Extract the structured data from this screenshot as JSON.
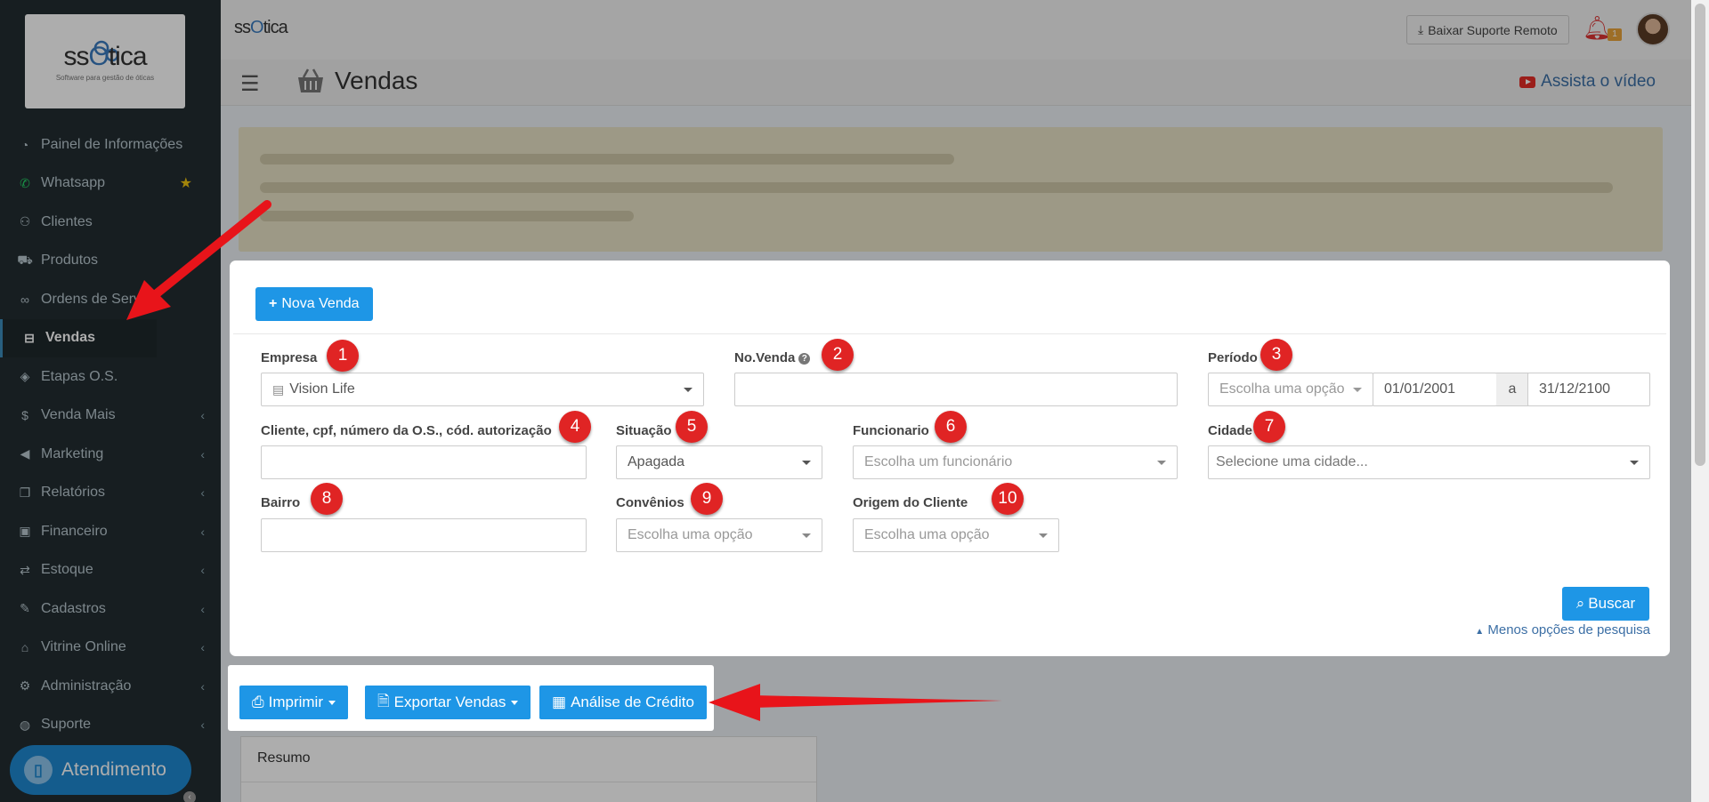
{
  "brand": {
    "name_prefix": "ss",
    "name_o": "O",
    "name_suffix": "tica",
    "tagline": "Software para gestão de óticas"
  },
  "sidebar": {
    "items": [
      {
        "label": "Painel de Informações",
        "icon": "dashboard-icon"
      },
      {
        "label": "Whatsapp",
        "icon": "whatsapp-icon"
      },
      {
        "label": "Clientes",
        "icon": "users-icon"
      },
      {
        "label": "Produtos",
        "icon": "cart-icon"
      },
      {
        "label": "Ordens de Serviço",
        "icon": "glasses-icon"
      },
      {
        "label": "Vendas",
        "icon": "basket-icon"
      },
      {
        "label": "Etapas O.S.",
        "icon": "tag-icon"
      },
      {
        "label": "Venda Mais",
        "icon": "dollar-icon"
      },
      {
        "label": "Marketing",
        "icon": "bullhorn-icon"
      },
      {
        "label": "Relatórios",
        "icon": "copy-icon"
      },
      {
        "label": "Financeiro",
        "icon": "money-icon"
      },
      {
        "label": "Estoque",
        "icon": "exchange-icon"
      },
      {
        "label": "Cadastros",
        "icon": "edit-icon"
      },
      {
        "label": "Vitrine Online",
        "icon": "shop-icon"
      },
      {
        "label": "Administração",
        "icon": "cogs-icon"
      },
      {
        "label": "Suporte",
        "icon": "globe-icon"
      }
    ],
    "support_button": "Atendimento"
  },
  "topbar": {
    "remote_support": "Baixar Suporte Remoto",
    "notification_count": "1"
  },
  "page": {
    "title": "Vendas",
    "video_link": "Assista o vídeo"
  },
  "search": {
    "new_sale": "Nova Venda",
    "company_label": "Empresa",
    "company_value": "Vision Life",
    "sale_number_label": "No.Venda",
    "period_label": "Período",
    "period_placeholder": "Escolha uma opção",
    "date_from": "01/01/2001",
    "date_separator": "a",
    "date_to": "31/12/2100",
    "client_label": "Cliente, cpf, número da O.S., cód. autorização",
    "status_label": "Situação",
    "status_value": "Apagada",
    "employee_label": "Funcionario",
    "employee_placeholder": "Escolha um funcionário",
    "city_label": "Cidade",
    "city_placeholder": "Selecione uma cidade...",
    "neighborhood_label": "Bairro",
    "agreements_label": "Convênios",
    "agreements_placeholder": "Escolha uma opção",
    "origin_label": "Origem do Cliente",
    "origin_placeholder": "Escolha uma opção",
    "search_button": "Buscar",
    "fewer_options": "Menos opções de pesquisa"
  },
  "badges": [
    "1",
    "2",
    "3",
    "4",
    "5",
    "6",
    "7",
    "8",
    "9",
    "10"
  ],
  "actions": {
    "print": "Imprimir",
    "export": "Exportar Vendas",
    "credit": "Análise de Crédito"
  },
  "summary": {
    "title": "Resumo"
  },
  "colors": {
    "primary": "#1e96e6",
    "badge": "#e02424",
    "sidebar": "#222d32",
    "arrow": "#e8141a"
  }
}
